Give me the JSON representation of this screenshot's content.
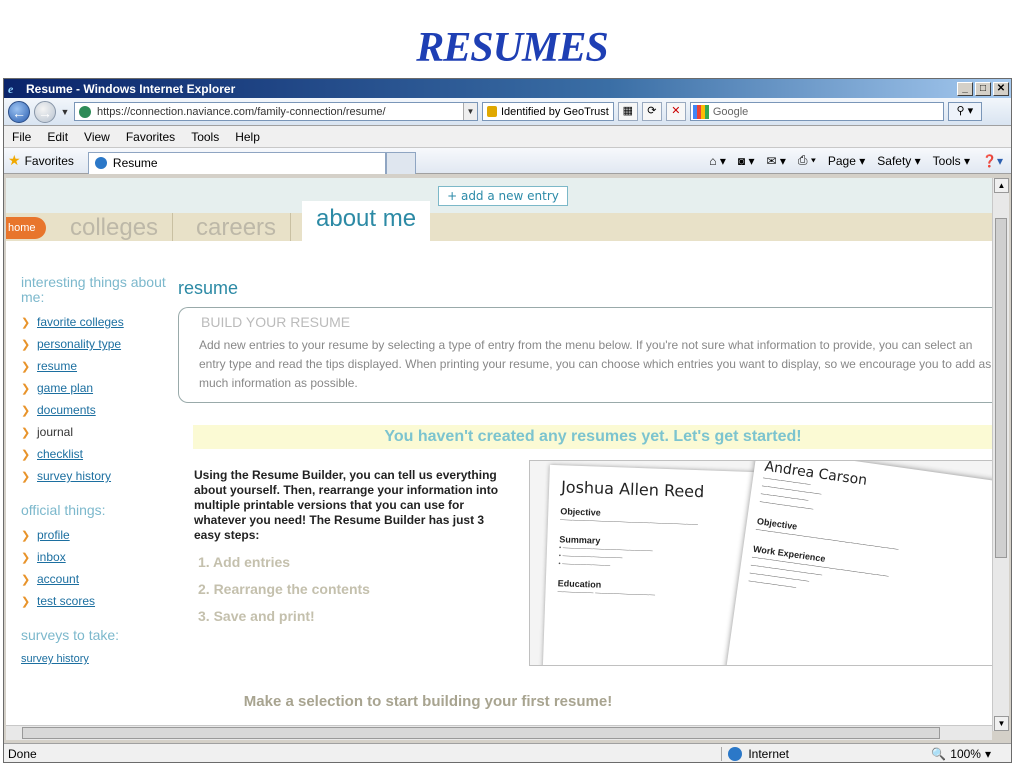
{
  "slide": {
    "title": "RESUMES"
  },
  "browser": {
    "window_title": "Resume - Windows Internet Explorer",
    "url": "https://connection.naviance.com/family-connection/resume/",
    "security_label": "Identified by GeoTrust",
    "search_placeholder": "Google",
    "menu": [
      "File",
      "Edit",
      "View",
      "Favorites",
      "Tools",
      "Help"
    ],
    "favorites_label": "Favorites",
    "tab_title": "Resume",
    "commands": [
      "Page ▾",
      "Safety ▾",
      "Tools ▾"
    ],
    "status_text": "Done",
    "zone": "Internet",
    "zoom": "100%"
  },
  "site": {
    "add_entry": "+ add a new entry",
    "home_tab": "home",
    "tabs": [
      "colleges",
      "careers",
      "about me"
    ]
  },
  "sidebar": {
    "heading1": "interesting things about me:",
    "items1": [
      "favorite colleges",
      "personality type",
      "resume",
      "game plan",
      "documents",
      "journal",
      "checklist",
      "survey history"
    ],
    "heading2": "official things:",
    "items2": [
      "profile",
      "inbox",
      "account",
      "test scores"
    ],
    "heading3": "surveys to take:",
    "survey_link": "survey history"
  },
  "main": {
    "title": "resume",
    "build_heading": "BUILD YOUR RESUME",
    "build_text": "Add new entries to your resume by selecting a type of entry from the menu below. If you're not sure what information to provide, you can select an entry type and read the tips displayed. When printing your resume, you can choose which entries you want to display, so we encourage you to add as much information as possible.",
    "banner": "You haven't created any resumes yet. Let's get started!",
    "intro": "Using the Resume Builder, you can tell us everything about yourself. Then, rearrange your information into multiple printable versions that you can use for whatever you need! The Resume Builder has just 3 easy steps:",
    "steps": [
      "1.  Add entries",
      "2.  Rearrange the contents",
      "3.  Save and print!"
    ],
    "make_selection": "Make a selection to start building your first resume!"
  },
  "sample_resumes": {
    "name1": "Joshua Allen Reed",
    "name2": "Andrea Carson",
    "headings1": [
      "Objective",
      "Summary",
      "Education"
    ],
    "headings2": [
      "Objective",
      "Work Experience"
    ]
  }
}
